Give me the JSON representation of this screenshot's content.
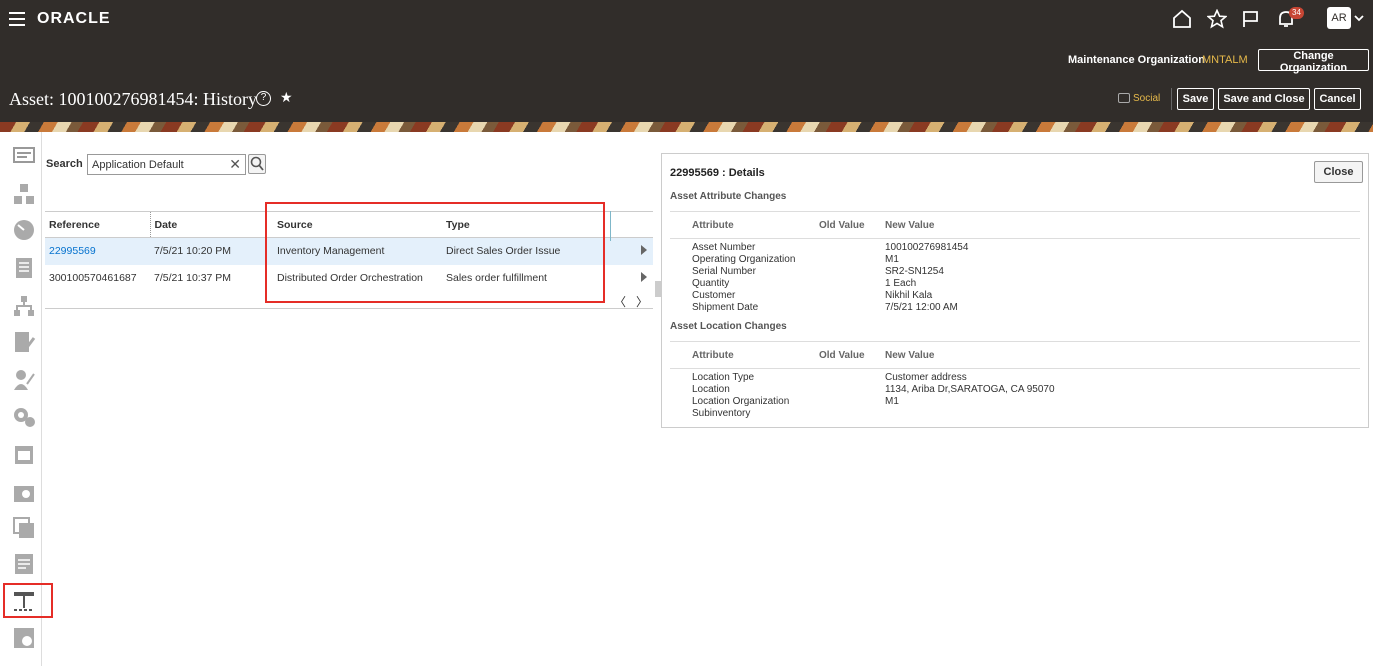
{
  "header": {
    "logo": "ORACLE",
    "notification_count": "34",
    "avatar_initials": "AR",
    "org_label": "Maintenance Organization",
    "org_value": "MNTALM",
    "change_org_button": "Change Organization"
  },
  "title_bar": {
    "page_title": "Asset: 100100276981454:",
    "page_subtitle": "History",
    "help_glyph": "?",
    "social_label": "Social",
    "save_button": "Save",
    "save_close_button": "Save and Close",
    "cancel_button": "Cancel"
  },
  "search": {
    "label": "Search",
    "value": "Application Default"
  },
  "grid": {
    "columns": [
      "Reference",
      "Date",
      "Source",
      "Type"
    ],
    "rows": [
      {
        "reference": "22995569",
        "date": "7/5/21 10:20 PM",
        "source": "Inventory Management",
        "type": "Direct Sales Order Issue"
      },
      {
        "reference": "300100570461687",
        "date": "7/5/21 10:37 PM",
        "source": "Distributed Order Orchestration",
        "type": "Sales order fulfillment"
      }
    ]
  },
  "details": {
    "title": "22995569 : Details",
    "close_button": "Close",
    "attr_section_title": "Asset Attribute Changes",
    "loc_section_title": "Asset Location Changes",
    "col_attribute": "Attribute",
    "col_old": "Old Value",
    "col_new": "New Value",
    "attribute_changes": [
      {
        "attribute": "Asset Number",
        "new": "100100276981454"
      },
      {
        "attribute": "Operating Organization",
        "new": "M1"
      },
      {
        "attribute": "Serial Number",
        "new": "SR2-SN1254"
      },
      {
        "attribute": "Quantity",
        "new": "1 Each"
      },
      {
        "attribute": "Customer",
        "new": "Nikhil Kala"
      },
      {
        "attribute": "Shipment Date",
        "new": "7/5/21 12:00 AM"
      }
    ],
    "location_changes": [
      {
        "attribute": "Location Type",
        "new": "Customer address"
      },
      {
        "attribute": "Location",
        "new": "1134, Ariba Dr,SARATOGA, CA 95070"
      },
      {
        "attribute": "Location Organization",
        "new": "M1"
      },
      {
        "attribute": "Subinventory",
        "new": ""
      }
    ]
  },
  "colors": {
    "header_bg": "#312d2a",
    "accent_gold": "#e6b94a",
    "highlight_red": "#e52d27",
    "link_blue": "#0572ce"
  }
}
